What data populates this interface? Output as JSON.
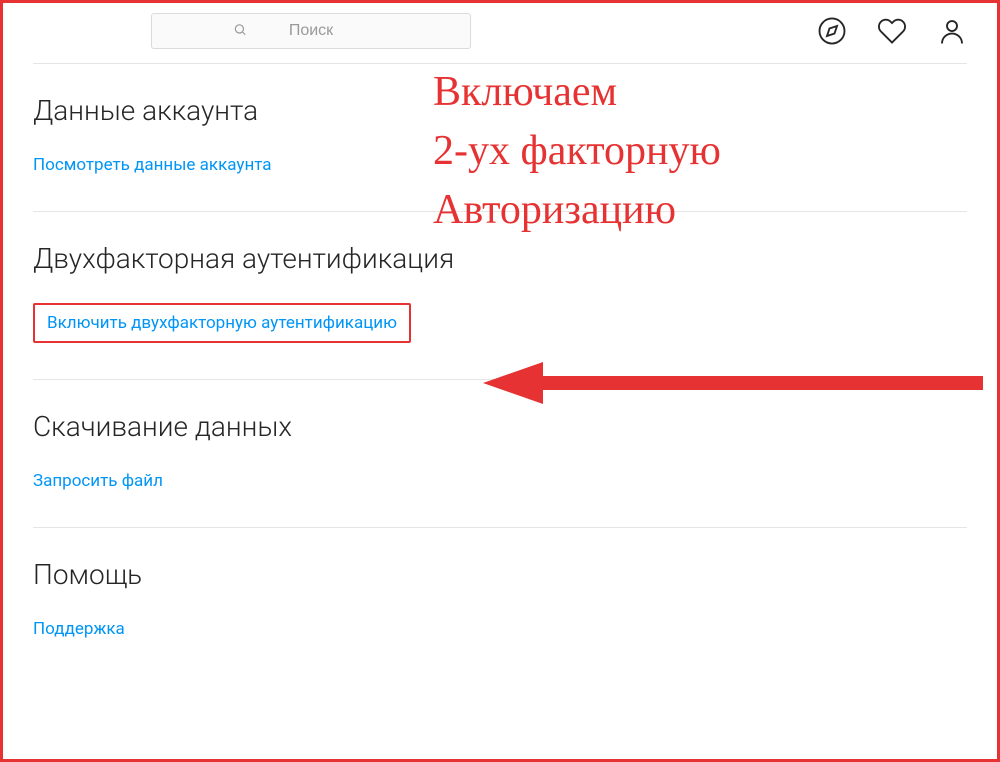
{
  "header": {
    "search_placeholder": "Поиск"
  },
  "sections": {
    "account": {
      "title": "Данные аккаунта",
      "link_label": "Посмотреть данные аккаунта"
    },
    "two_factor": {
      "title": "Двухфакторная аутентификация",
      "link_label": "Включить двухфакторную аутентификацию"
    },
    "download": {
      "title": "Скачивание данных",
      "link_label": "Запросить файл"
    },
    "help": {
      "title": "Помощь",
      "link_label": "Поддержка"
    }
  },
  "annotation": {
    "line1": "Включаем",
    "line2": "2-ух факторную",
    "line3": "Авторизацию"
  }
}
